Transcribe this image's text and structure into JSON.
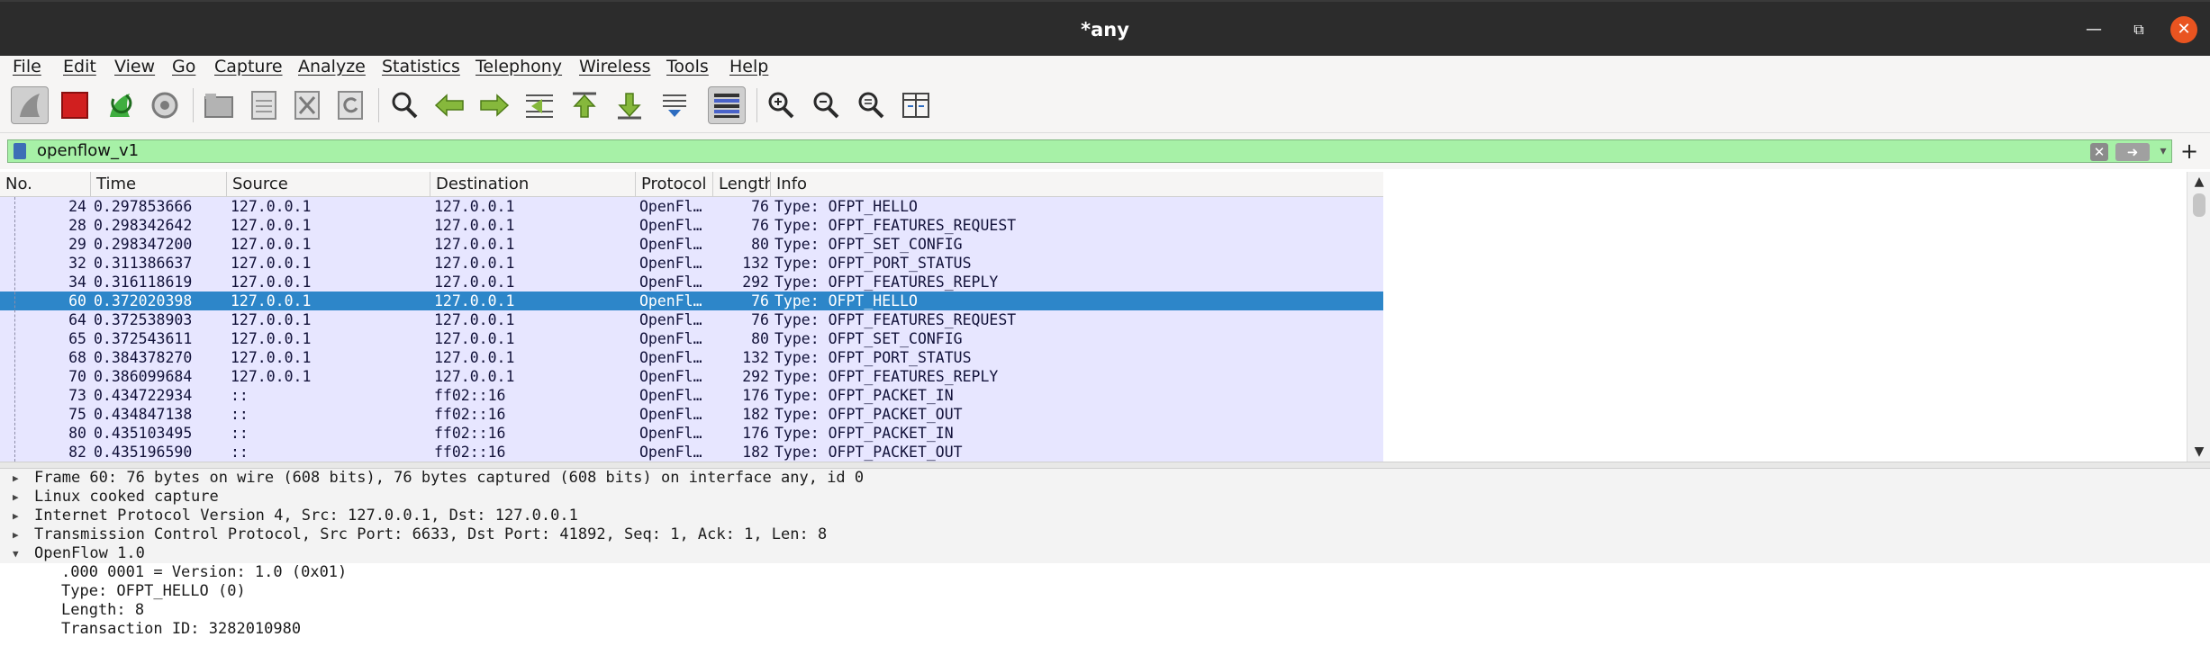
{
  "window": {
    "title": "*any"
  },
  "menu": [
    "File",
    "Edit",
    "View",
    "Go",
    "Capture",
    "Analyze",
    "Statistics",
    "Telephony",
    "Wireless",
    "Tools",
    "Help"
  ],
  "toolbar": {
    "icons": [
      "shark-fin-start-icon",
      "stop-capture-icon",
      "restart-capture-icon",
      "capture-options-icon",
      "open-file-icon",
      "save-file-icon",
      "close-file-icon",
      "reload-file-icon",
      "find-packet-icon",
      "go-back-icon",
      "go-forward-icon",
      "go-to-packet-icon",
      "first-packet-icon",
      "last-packet-icon",
      "autoscroll-icon",
      "colorize-icon",
      "zoom-in-icon",
      "zoom-out-icon",
      "normal-size-icon",
      "resize-columns-icon"
    ]
  },
  "filter": {
    "value": "openflow_v1"
  },
  "packet_list": {
    "columns": [
      "No.",
      "Time",
      "Source",
      "Destination",
      "Protocol",
      "Length",
      "Info"
    ],
    "selected_index": 5,
    "rows": [
      {
        "no": "24",
        "time": "0.297853666",
        "src": "127.0.0.1",
        "dst": "127.0.0.1",
        "proto": "OpenFl…",
        "len": "76",
        "info": "Type: OFPT_HELLO"
      },
      {
        "no": "28",
        "time": "0.298342642",
        "src": "127.0.0.1",
        "dst": "127.0.0.1",
        "proto": "OpenFl…",
        "len": "76",
        "info": "Type: OFPT_FEATURES_REQUEST"
      },
      {
        "no": "29",
        "time": "0.298347200",
        "src": "127.0.0.1",
        "dst": "127.0.0.1",
        "proto": "OpenFl…",
        "len": "80",
        "info": "Type: OFPT_SET_CONFIG"
      },
      {
        "no": "32",
        "time": "0.311386637",
        "src": "127.0.0.1",
        "dst": "127.0.0.1",
        "proto": "OpenFl…",
        "len": "132",
        "info": "Type: OFPT_PORT_STATUS"
      },
      {
        "no": "34",
        "time": "0.316118619",
        "src": "127.0.0.1",
        "dst": "127.0.0.1",
        "proto": "OpenFl…",
        "len": "292",
        "info": "Type: OFPT_FEATURES_REPLY"
      },
      {
        "no": "60",
        "time": "0.372020398",
        "src": "127.0.0.1",
        "dst": "127.0.0.1",
        "proto": "OpenFl…",
        "len": "76",
        "info": "Type: OFPT_HELLO"
      },
      {
        "no": "64",
        "time": "0.372538903",
        "src": "127.0.0.1",
        "dst": "127.0.0.1",
        "proto": "OpenFl…",
        "len": "76",
        "info": "Type: OFPT_FEATURES_REQUEST"
      },
      {
        "no": "65",
        "time": "0.372543611",
        "src": "127.0.0.1",
        "dst": "127.0.0.1",
        "proto": "OpenFl…",
        "len": "80",
        "info": "Type: OFPT_SET_CONFIG"
      },
      {
        "no": "68",
        "time": "0.384378270",
        "src": "127.0.0.1",
        "dst": "127.0.0.1",
        "proto": "OpenFl…",
        "len": "132",
        "info": "Type: OFPT_PORT_STATUS"
      },
      {
        "no": "70",
        "time": "0.386099684",
        "src": "127.0.0.1",
        "dst": "127.0.0.1",
        "proto": "OpenFl…",
        "len": "292",
        "info": "Type: OFPT_FEATURES_REPLY"
      },
      {
        "no": "73",
        "time": "0.434722934",
        "src": "::",
        "dst": "ff02::16",
        "proto": "OpenFl…",
        "len": "176",
        "info": "Type: OFPT_PACKET_IN"
      },
      {
        "no": "75",
        "time": "0.434847138",
        "src": "::",
        "dst": "ff02::16",
        "proto": "OpenFl…",
        "len": "182",
        "info": "Type: OFPT_PACKET_OUT"
      },
      {
        "no": "80",
        "time": "0.435103495",
        "src": "::",
        "dst": "ff02::16",
        "proto": "OpenFl…",
        "len": "176",
        "info": "Type: OFPT_PACKET_IN"
      },
      {
        "no": "82",
        "time": "0.435196590",
        "src": "::",
        "dst": "ff02::16",
        "proto": "OpenFl…",
        "len": "182",
        "info": "Type: OFPT_PACKET_OUT"
      }
    ]
  },
  "details": [
    {
      "text": "Frame 60: 76 bytes on wire (608 bits), 76 bytes captured (608 bits) on interface any, id 0",
      "expanded": false,
      "child": false
    },
    {
      "text": "Linux cooked capture",
      "expanded": false,
      "child": false
    },
    {
      "text": "Internet Protocol Version 4, Src: 127.0.0.1, Dst: 127.0.0.1",
      "expanded": false,
      "child": false
    },
    {
      "text": "Transmission Control Protocol, Src Port: 6633, Dst Port: 41892, Seq: 1, Ack: 1, Len: 8",
      "expanded": false,
      "child": false
    },
    {
      "text": "OpenFlow 1.0",
      "expanded": true,
      "child": false
    },
    {
      "text": ".000 0001 = Version: 1.0 (0x01)",
      "child": true
    },
    {
      "text": "Type: OFPT_HELLO (0)",
      "child": true
    },
    {
      "text": "Length: 8",
      "child": true
    },
    {
      "text": "Transaction ID: 3282010980",
      "child": true
    }
  ],
  "colors": {
    "row_bg": "#e7e6ff",
    "selected_bg": "#2d86c9",
    "filter_bg": "#a7f1a7",
    "titlebar_bg": "#2c2c2c",
    "close_btn": "#e95420"
  }
}
